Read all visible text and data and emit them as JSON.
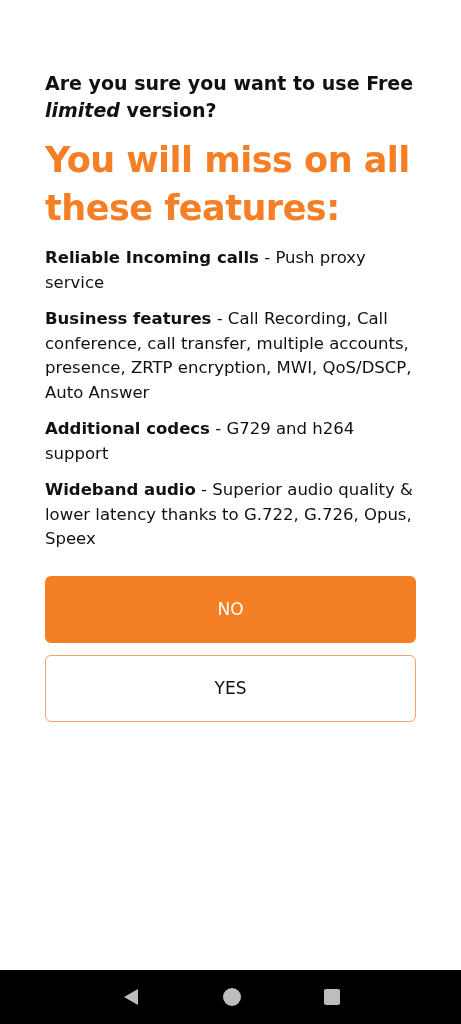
{
  "question": "Are you sure you want to use Free *limited* version?",
  "headline": "You will miss on all these features:",
  "features": [
    {
      "text": "**Reliable Incoming calls** - Push proxy service"
    },
    {
      "text": "**Business features** - Call Recording, Call conference, call transfer, multiple accounts, presence, ZRTP encryption, MWI, QoS/DSCP, Auto Answer"
    },
    {
      "text": "**Additional codecs** - G729 and h264 support"
    },
    {
      "text": "**Wideband audio** - Superior audio quality & lower latency thanks to G.722, G.726, Opus, Speex"
    }
  ],
  "buttons": [
    {
      "label": "NO",
      "kind": "primary"
    },
    {
      "label": "YES",
      "kind": "outline"
    }
  ]
}
